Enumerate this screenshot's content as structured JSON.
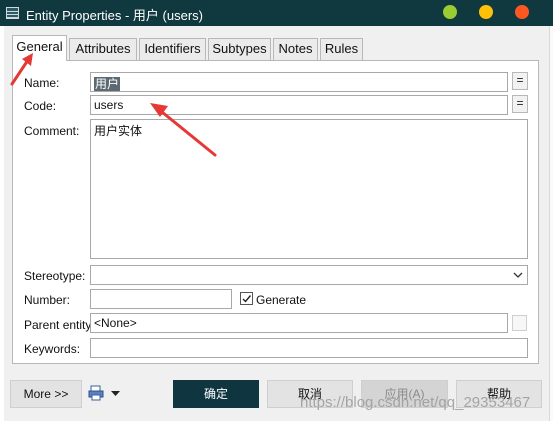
{
  "window": {
    "title": "Entity Properties - 用户 (users)",
    "controls": [
      "#9acd32",
      "#ffc107",
      "#ff5722"
    ]
  },
  "tabs": [
    {
      "label": "General",
      "active": true
    },
    {
      "label": "Attributes",
      "active": false
    },
    {
      "label": "Identifiers",
      "active": false
    },
    {
      "label": "Subtypes",
      "active": false
    },
    {
      "label": "Notes",
      "active": false
    },
    {
      "label": "Rules",
      "active": false
    }
  ],
  "form": {
    "name_label": "Name:",
    "name_value": "用户",
    "code_label": "Code:",
    "code_value": "users",
    "comment_label": "Comment:",
    "comment_value": "用户实体",
    "stereotype_label": "Stereotype:",
    "stereotype_value": "",
    "number_label": "Number:",
    "number_value": "",
    "generate_label": "Generate",
    "generate_checked": true,
    "parent_label": "Parent entity:",
    "parent_value": "<None>",
    "keywords_label": "Keywords:",
    "keywords_value": "",
    "equals_symbol": "="
  },
  "buttons": {
    "more": "More >>",
    "ok": "确定",
    "cancel": "取消",
    "apply": "应用(A)",
    "help": "帮助"
  },
  "watermark": "https://blog.csdn.net/qq_29353467",
  "colors": {
    "titlebar": "#10383f",
    "annotation": "#e53935",
    "primary_button": "#0f3540"
  }
}
